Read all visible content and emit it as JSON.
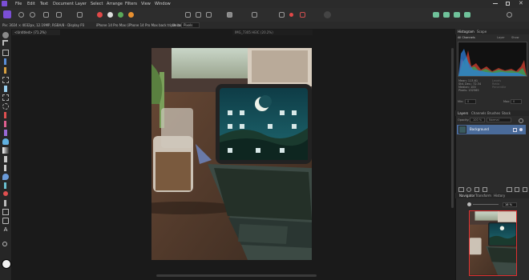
{
  "menu": {
    "items": [
      "File",
      "Edit",
      "Text",
      "Document",
      "Layer",
      "Select",
      "Arrange",
      "Filters",
      "View",
      "Window"
    ]
  },
  "context_bar": {
    "pixel_info": "Pix:  3024 × 4032px, 12.19MP, RGBA/8 - Display P3",
    "camera_info": "iPhone 14 Pro Max (iPhone 14 Pro Max back triple cam...",
    "units_label": "Units:",
    "units_value": "Pixels"
  },
  "documents": {
    "tabs": [
      "<Untitled> (71.2%)",
      "IMG_7305 HEIC (20.2%)"
    ]
  },
  "histogram": {
    "tabs": [
      "Histogram",
      "Scope"
    ],
    "channel": "All Channels",
    "option1": "Layer",
    "option2": "Show",
    "stats_left": [
      "Mean: 113.61",
      "Std. Dev.: 72.34",
      "Median: 100",
      "Pixels: 152565"
    ],
    "stats_right": [
      "Levels",
      "Ratio",
      "Percentile"
    ],
    "min_label": "Min:",
    "min_value": "0",
    "max_label": "Max:",
    "max_value": "0"
  },
  "layers": {
    "tabs": [
      "Layers",
      "Channels",
      "Brushes",
      "Stock"
    ],
    "opacity_label": "Opacity:",
    "opacity_value": "100 %",
    "blend_mode": "Normal",
    "layer_name": "Background"
  },
  "navigator": {
    "tabs": [
      "Navigator",
      "Transform",
      "History"
    ],
    "zoom_value": "16 %"
  },
  "colors": {
    "accent_purple": "#7b4fd6",
    "selection_blue": "#4a6b9a",
    "icon_red": "#e04848",
    "icon_green": "#5aaa5a"
  }
}
